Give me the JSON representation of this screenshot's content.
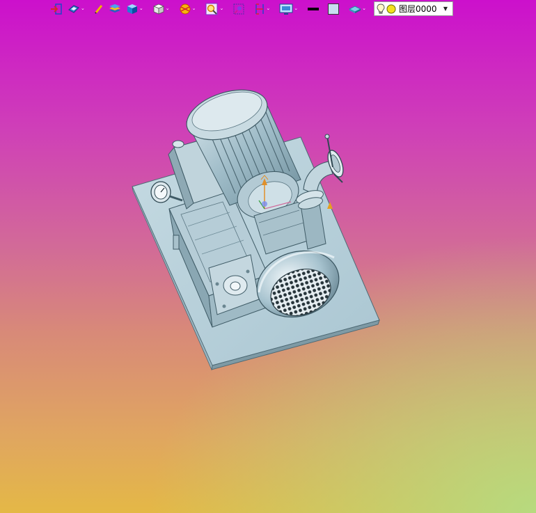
{
  "toolbar": {
    "buttons": [
      {
        "name": "exit-sketch-icon",
        "dropdown": false
      },
      {
        "name": "view-orient-icon",
        "dropdown": true
      },
      {
        "name": "pencil-icon",
        "dropdown": false
      },
      {
        "name": "layers-stack-icon",
        "dropdown": false
      },
      {
        "name": "cube-display-icon",
        "dropdown": true
      },
      {
        "name": "white-cube-icon",
        "dropdown": true
      },
      {
        "name": "section-view-icon",
        "dropdown": true
      },
      {
        "name": "zoom-icon",
        "dropdown": true
      },
      {
        "name": "render-mode-icon",
        "dropdown": false
      },
      {
        "name": "measure-icon",
        "dropdown": true
      },
      {
        "name": "display-settings-icon",
        "dropdown": true
      },
      {
        "name": "line-color-icon",
        "dropdown": false
      },
      {
        "name": "fill-color-icon",
        "dropdown": false
      },
      {
        "name": "material-icon",
        "dropdown": true
      }
    ],
    "layer": {
      "value": "图层0000"
    }
  },
  "colors": {
    "model_fill": "#b9d2dc",
    "model_shade": "#8fb0bd",
    "model_dark": "#5e7c88"
  }
}
